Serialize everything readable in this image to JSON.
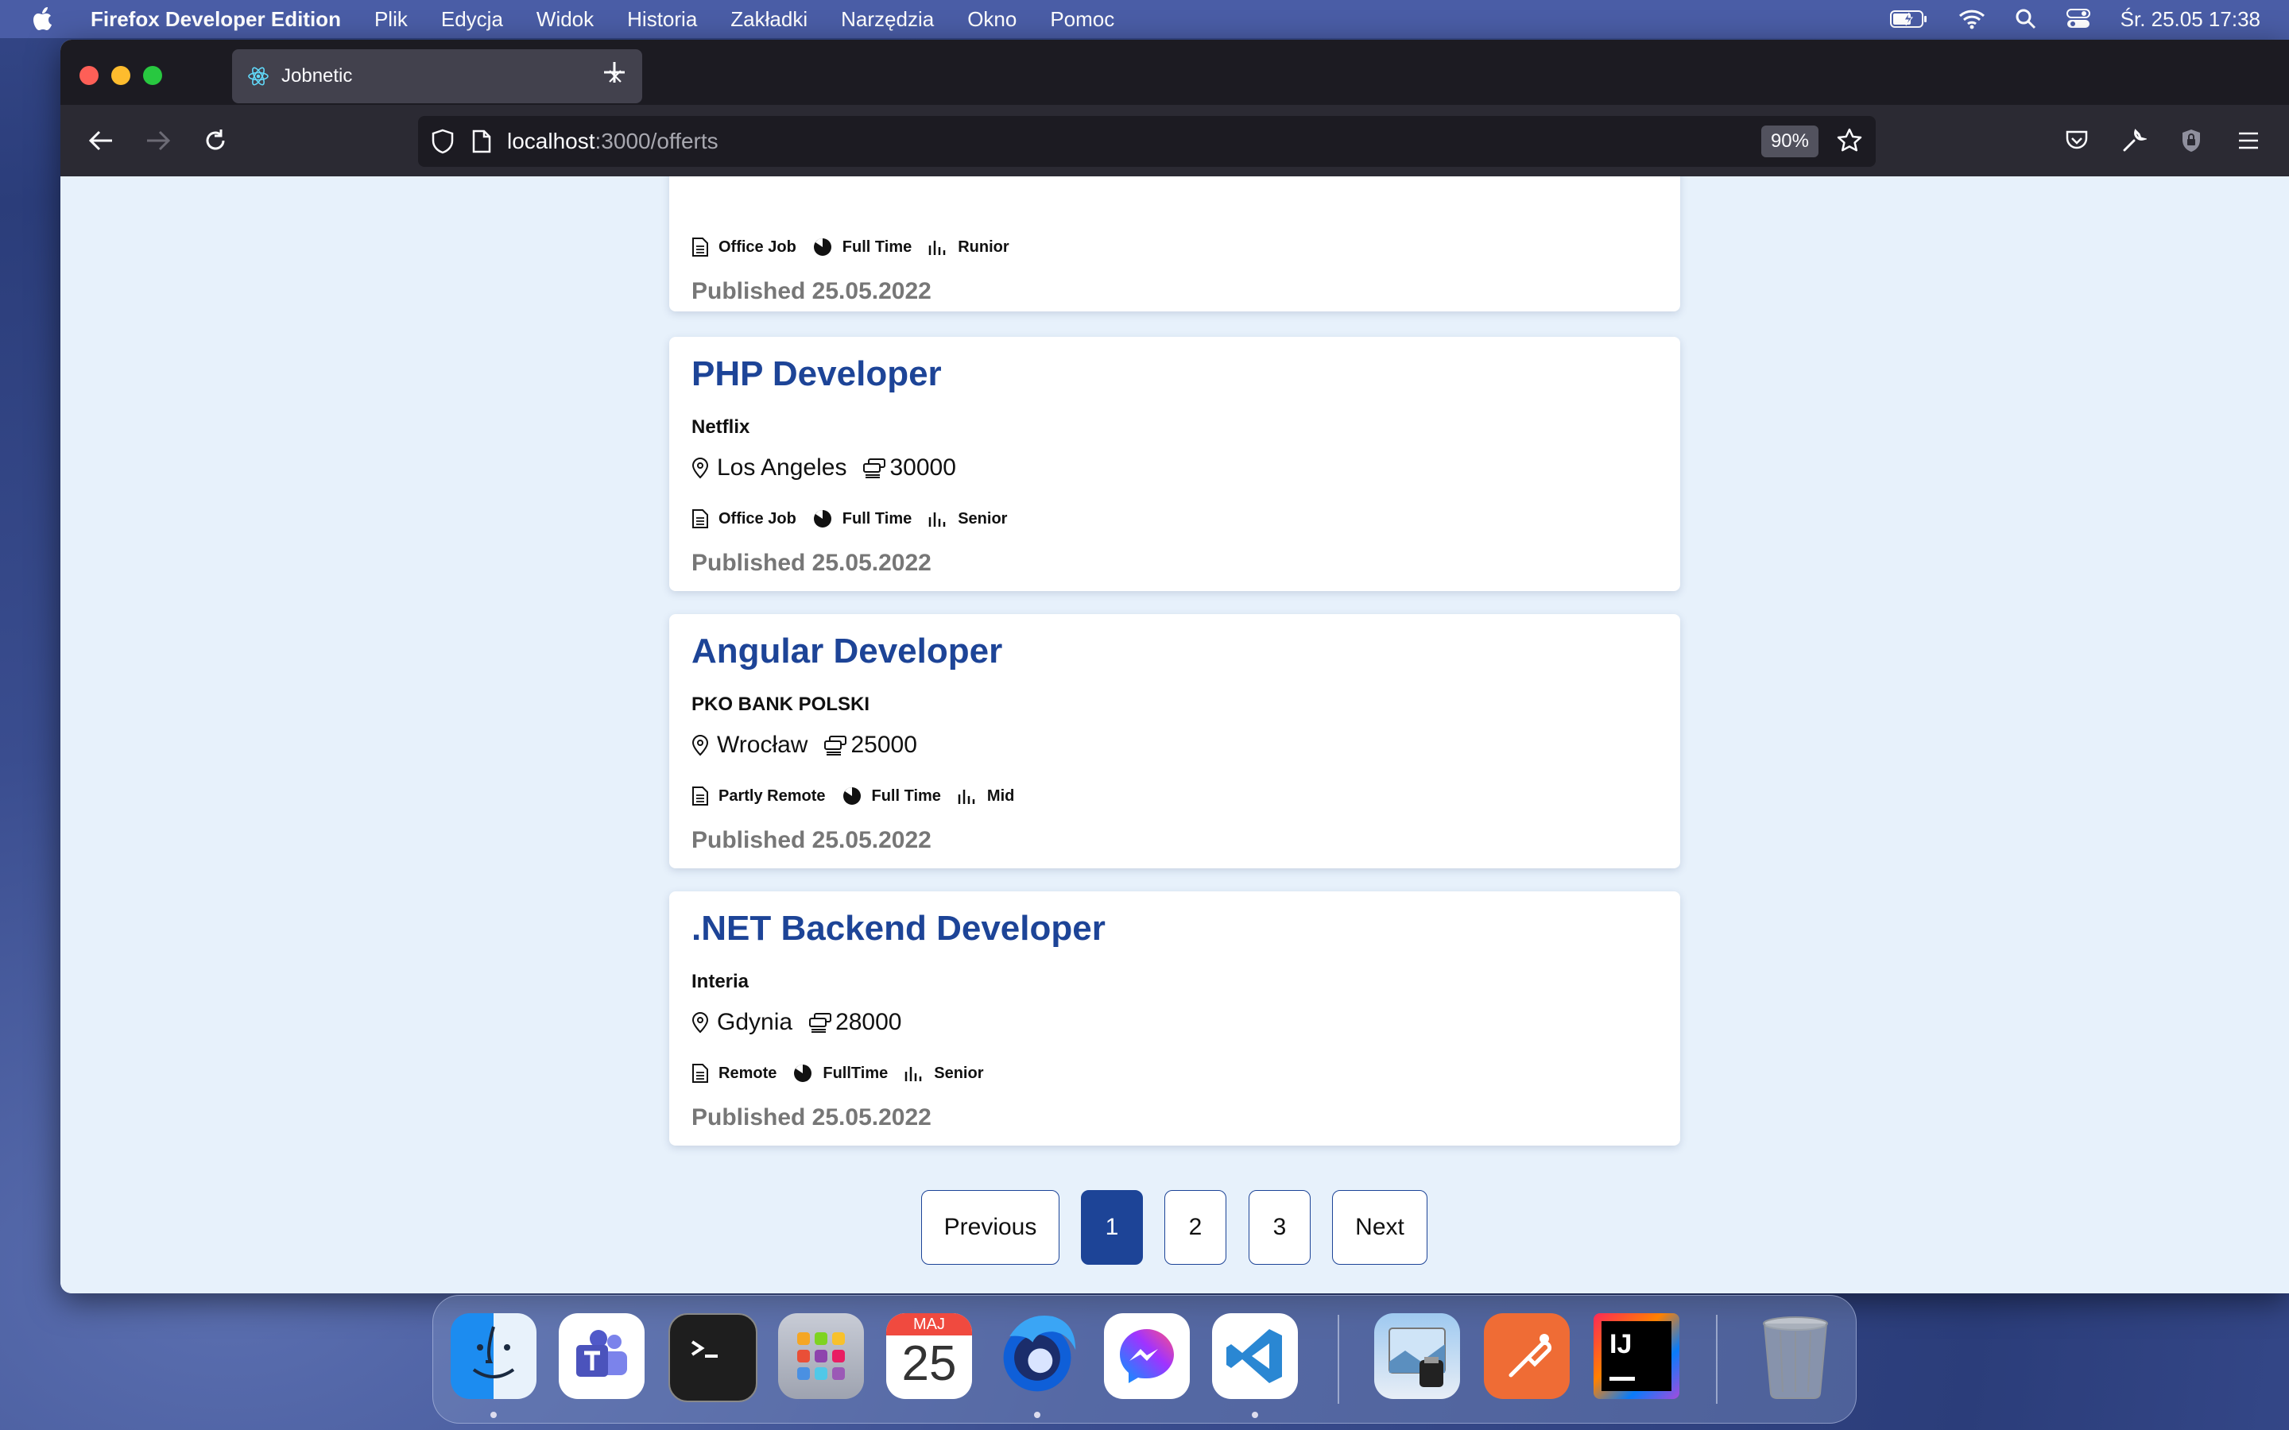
{
  "menubar": {
    "app_name": "Firefox Developer Edition",
    "menus": [
      "Plik",
      "Edycja",
      "Widok",
      "Historia",
      "Zakładki",
      "Narzędzia",
      "Okno",
      "Pomoc"
    ],
    "clock": "Śr. 25.05  17:38"
  },
  "browser": {
    "tab_title": "Jobnetic",
    "url_host": "localhost",
    "url_path": ":3000/offerts",
    "zoom": "90%"
  },
  "offers": [
    {
      "title": "",
      "company": "",
      "location": "",
      "salary": "",
      "work_mode": "Office Job",
      "time": "Full Time",
      "level": "Runior",
      "published": "Published 25.05.2022"
    },
    {
      "title": "PHP Developer",
      "company": "Netflix",
      "location": "Los Angeles",
      "salary": "30000",
      "work_mode": "Office Job",
      "time": "Full Time",
      "level": "Senior",
      "published": "Published 25.05.2022"
    },
    {
      "title": "Angular Developer",
      "company": "PKO BANK POLSKI",
      "location": "Wrocław",
      "salary": "25000",
      "work_mode": "Partly Remote",
      "time": "Full Time",
      "level": "Mid",
      "published": "Published 25.05.2022"
    },
    {
      "title": ".NET Backend Developer",
      "company": "Interia",
      "location": "Gdynia",
      "salary": "28000",
      "work_mode": "Remote",
      "time": "FullTime",
      "level": "Senior",
      "published": "Published 25.05.2022"
    }
  ],
  "pagination": {
    "previous": "Previous",
    "pages": [
      "1",
      "2",
      "3"
    ],
    "active": "1",
    "next": "Next"
  },
  "dock": {
    "calendar_month": "MAJ",
    "calendar_day": "25",
    "apps": [
      "finder-icon",
      "teams-icon",
      "terminal-icon",
      "launchpad-icon",
      "calendar-icon",
      "firefox-icon",
      "messenger-icon",
      "vscode-icon",
      "preview-icon",
      "postman-icon",
      "intellij-icon",
      "trash-icon"
    ]
  }
}
